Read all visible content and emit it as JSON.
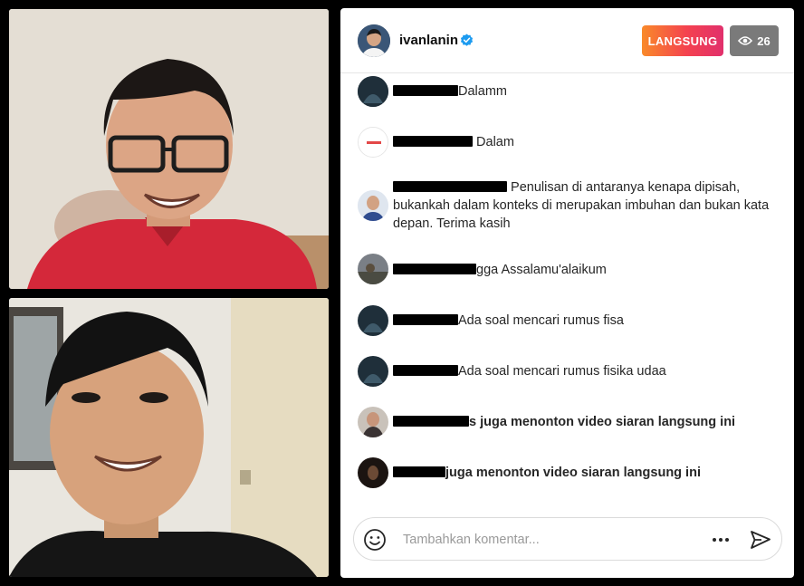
{
  "colors": {
    "live_gradient_start": "#f98a2a",
    "live_gradient_end": "#e1306c",
    "verified": "#1d9bf0",
    "viewer_badge": "#7a7a7a"
  },
  "videos": [
    {
      "name": "video-host",
      "description_icon": "person-video"
    },
    {
      "name": "video-guest",
      "description_icon": "person-video"
    }
  ],
  "header": {
    "username": "ivanlanin",
    "verified_icon": "verified-badge-icon",
    "live_label": "LANGSUNG",
    "viewer_icon": "eye-icon",
    "viewer_count": "26"
  },
  "comments": [
    {
      "user_hidden": true,
      "text": "Dalamm",
      "bold": false
    },
    {
      "user_hidden": true,
      "text": "Dalam",
      "bold": false
    },
    {
      "user_hidden": true,
      "text": "Penulisan di antaranya kenapa dipisah, bukankah dalam konteks di merupakan imbuhan dan bukan kata depan. Terima kasih",
      "bold": false
    },
    {
      "user_hidden": true,
      "text": "Assalamu'alaikum",
      "bold": false,
      "visible_user_suffix": "gga"
    },
    {
      "user_hidden": true,
      "text": "Ada soal mencari rumus fisa",
      "bold": false
    },
    {
      "user_hidden": true,
      "text": "Ada soal mencari rumus fisika udaa",
      "bold": false
    },
    {
      "user_hidden": true,
      "text": "juga menonton video siaran langsung ini",
      "bold": true,
      "visible_user_suffix": "s"
    },
    {
      "user_hidden": true,
      "text": "juga menonton video siaran langsung ini",
      "bold": true
    }
  ],
  "composer": {
    "placeholder": "Tambahkan komentar...",
    "emoji_icon": "smile-icon",
    "more_icon": "more-dots-icon",
    "send_icon": "send-icon"
  }
}
